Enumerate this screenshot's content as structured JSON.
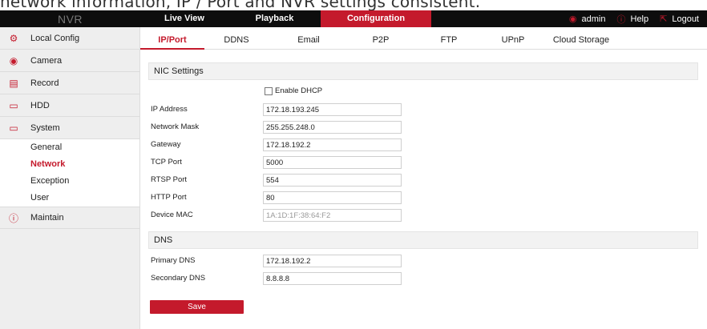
{
  "caption": "network information, IP / Port and NVR settings consistent.",
  "topbar": {
    "logo": "NVR",
    "tabs": [
      {
        "label": "Live View"
      },
      {
        "label": "Playback"
      },
      {
        "label": "Configuration"
      }
    ],
    "user": "admin",
    "help": "Help",
    "logout": "Logout"
  },
  "sidebar": {
    "items": [
      {
        "label": "Local Config",
        "icon": "gear-icon"
      },
      {
        "label": "Camera",
        "icon": "camera-icon"
      },
      {
        "label": "Record",
        "icon": "record-icon"
      },
      {
        "label": "HDD",
        "icon": "hdd-icon"
      },
      {
        "label": "System",
        "icon": "monitor-icon"
      },
      {
        "label": "Maintain",
        "icon": "info-icon"
      }
    ],
    "system_sub": [
      "General",
      "Network",
      "Exception",
      "User"
    ],
    "active_sub": "Network"
  },
  "subtabs": [
    "IP/Port",
    "DDNS",
    "Email",
    "P2P",
    "FTP",
    "UPnP",
    "Cloud Storage"
  ],
  "nic": {
    "title": "NIC Settings",
    "dhcp_label": "Enable DHCP",
    "dhcp_checked": false,
    "fields": [
      {
        "label": "IP Address",
        "value": "172.18.193.245"
      },
      {
        "label": "Network Mask",
        "value": "255.255.248.0"
      },
      {
        "label": "Gateway",
        "value": "172.18.192.2"
      },
      {
        "label": "TCP Port",
        "value": "5000"
      },
      {
        "label": "RTSP Port",
        "value": "554"
      },
      {
        "label": "HTTP Port",
        "value": "80"
      },
      {
        "label": "Device MAC",
        "value": "1A:1D:1F:38:64:F2"
      }
    ]
  },
  "dns": {
    "title": "DNS",
    "fields": [
      {
        "label": "Primary DNS",
        "value": "172.18.192.2"
      },
      {
        "label": "Secondary DNS",
        "value": "8.8.8.8"
      }
    ]
  },
  "save_label": "Save",
  "colors": {
    "accent": "#c41a2c",
    "topbar": "#0d0d0d",
    "sidebar": "#eeeeee"
  }
}
